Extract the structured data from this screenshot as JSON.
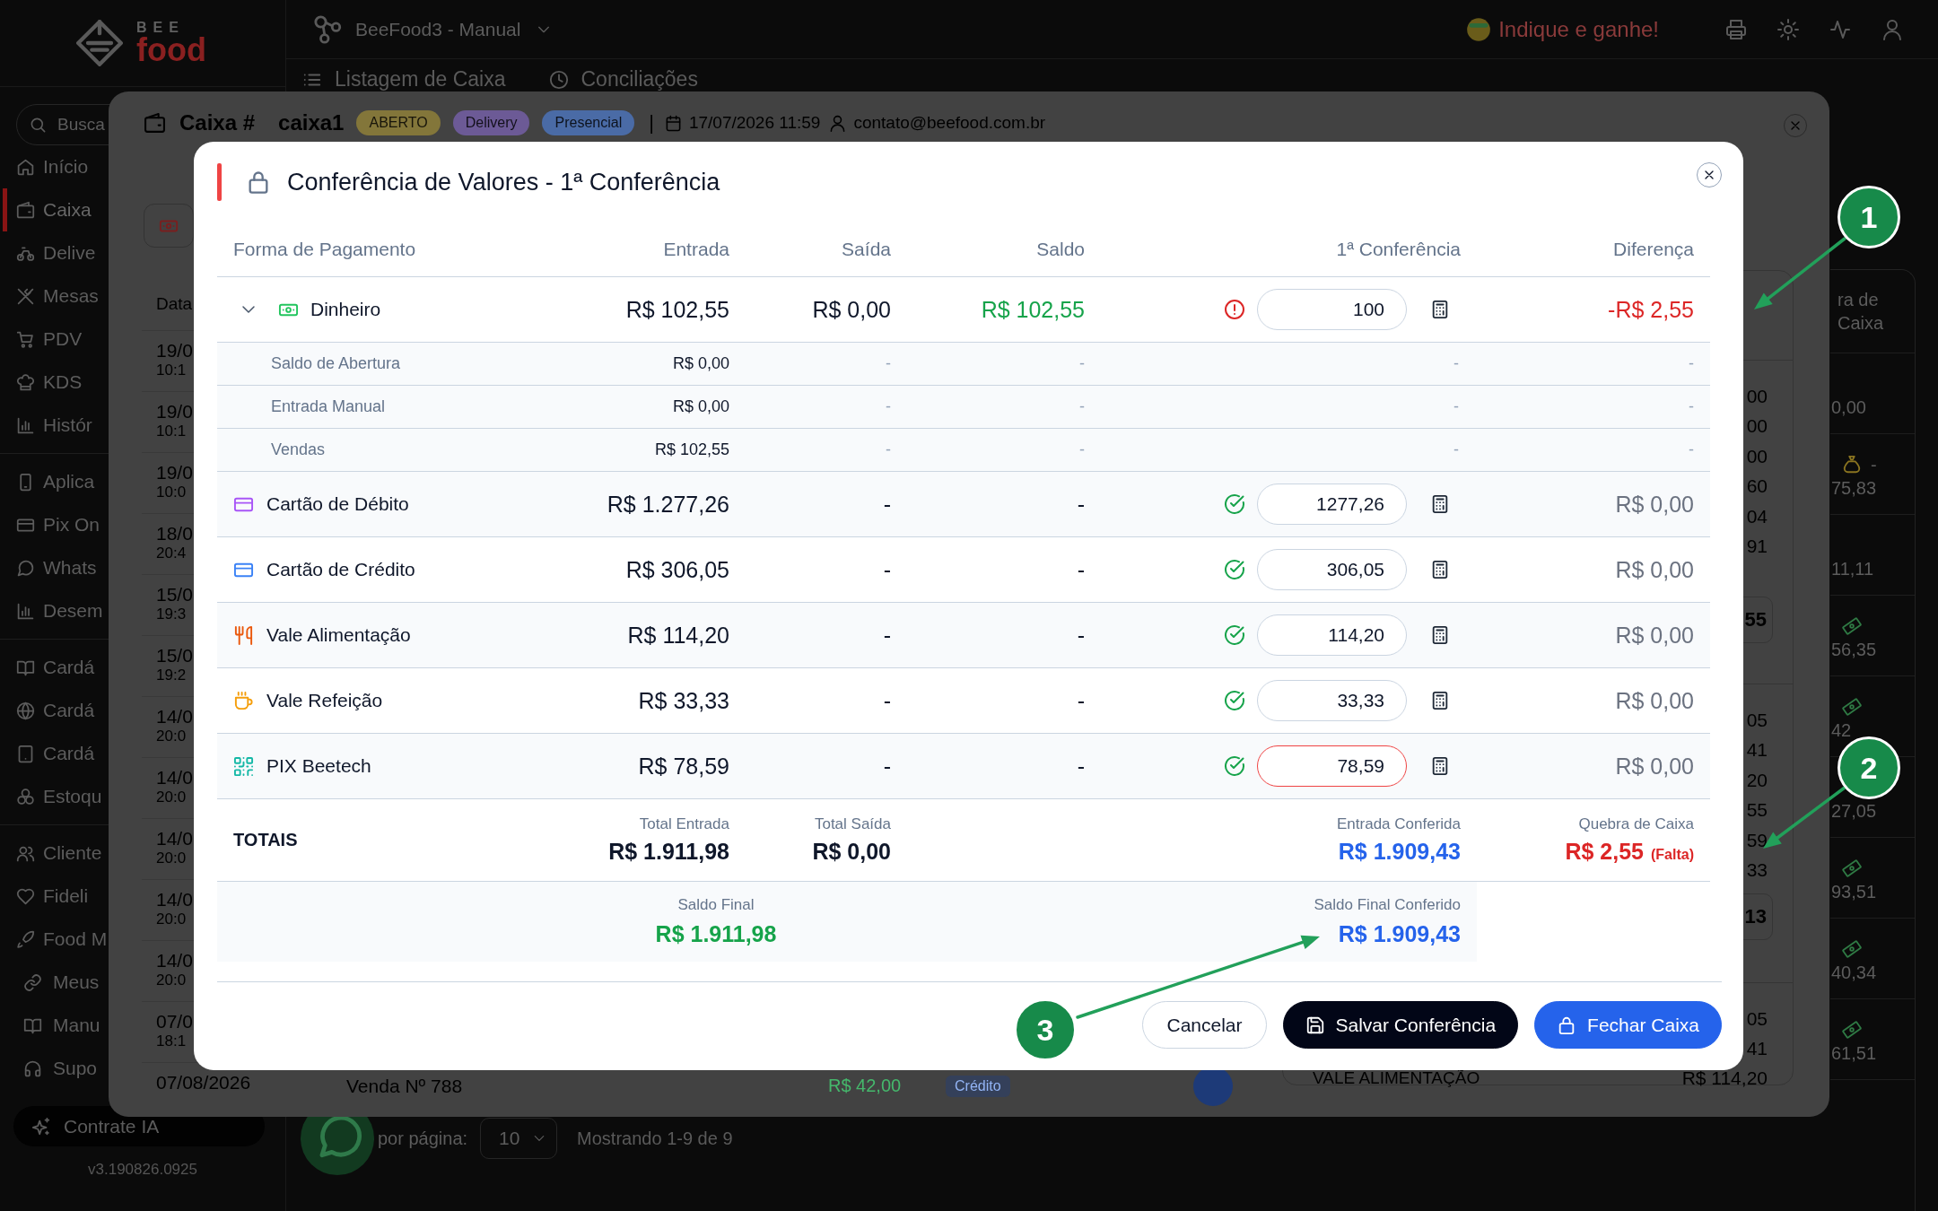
{
  "app": {
    "logo": {
      "top": "BEE",
      "bottom": "food"
    },
    "store_selector": {
      "label": "BeeFood3 - Manual"
    },
    "referral": {
      "label": "Indique e ganhe!"
    },
    "page_tabs": [
      {
        "label": "Listagem de Caixa"
      },
      {
        "label": "Conciliações"
      }
    ],
    "sidebar": {
      "search": {
        "placeholder": "Busca"
      },
      "groups": [
        {
          "items": [
            {
              "kind": "home",
              "label": "Início",
              "selected": false
            },
            {
              "kind": "wallet",
              "label": "Caixa",
              "selected": true
            },
            {
              "kind": "bike",
              "label": "Delive",
              "selected": false
            },
            {
              "kind": "dining",
              "label": "Mesas",
              "selected": false
            },
            {
              "kind": "cart",
              "label": "PDV",
              "selected": false
            },
            {
              "kind": "chef",
              "label": "KDS",
              "selected": false
            },
            {
              "kind": "chart",
              "label": "Histór",
              "selected": false
            }
          ]
        },
        {
          "items": [
            {
              "kind": "phone",
              "label": "Aplica",
              "selected": false
            },
            {
              "kind": "card",
              "label": "Pix On",
              "selected": false
            },
            {
              "kind": "chat",
              "label": "Whats",
              "selected": false
            },
            {
              "kind": "chart",
              "label": "Desem",
              "selected": false
            }
          ]
        },
        {
          "items": [
            {
              "kind": "book",
              "label": "Cardá",
              "selected": false
            },
            {
              "kind": "globe",
              "label": "Cardá",
              "selected": false
            },
            {
              "kind": "tablet",
              "label": "Cardá",
              "selected": false
            },
            {
              "kind": "boxes",
              "label": "Estoqu",
              "selected": false
            }
          ]
        },
        {
          "items": [
            {
              "kind": "users",
              "label": "Cliente",
              "selected": false
            },
            {
              "kind": "heart",
              "label": "Fideli",
              "selected": false
            },
            {
              "kind": "rocket",
              "label": "Food M",
              "selected": false
            }
          ]
        }
      ],
      "footer_links": [
        {
          "kind": "link",
          "label": "Meus"
        },
        {
          "kind": "book",
          "label": "Manu"
        },
        {
          "kind": "headset",
          "label": "Supo"
        }
      ],
      "cta": {
        "label": "Contrate IA"
      },
      "version": "v3.190826.0925"
    },
    "table_card": {
      "header": "ra de Caixa",
      "rows": [
        {
          "kind": "plain",
          "value": "0,00"
        },
        {
          "kind": "bag",
          "note": "-",
          "value": "75,83"
        },
        {
          "kind": "plain",
          "value": "11,11"
        },
        {
          "kind": "cash",
          "value": "56,35"
        },
        {
          "kind": "cash",
          "value": "42"
        },
        {
          "kind": "plain",
          "value": "27,05"
        },
        {
          "kind": "cash",
          "value": "93,51"
        },
        {
          "kind": "cash",
          "value": "40,34"
        },
        {
          "kind": "cash",
          "value": "61,51"
        }
      ]
    },
    "pagination": {
      "per_page_label": "por página:",
      "per_page": "10",
      "summary": "Mostrando 1-9 de 9"
    }
  },
  "cash_dialog": {
    "title": "Caixa #",
    "register": "caixa1",
    "badges": [
      {
        "label": "ABERTO",
        "color": "#83763a"
      },
      {
        "label": "Delivery",
        "color": "#6c5a96"
      },
      {
        "label": "Presencial",
        "color": "#4a6ba6"
      }
    ],
    "separator": "|",
    "opened_at": "17/07/2026 11:59",
    "user": "contato@beefood.com.br",
    "sales": {
      "column": "Data",
      "rows": [
        {
          "date": "19/0",
          "time": "10:1"
        },
        {
          "date": "19/0",
          "time": "10:1"
        },
        {
          "date": "19/0",
          "time": "10:0"
        },
        {
          "date": "18/0",
          "time": "20:4"
        },
        {
          "date": "15/0",
          "time": "19:3"
        },
        {
          "date": "15/0",
          "time": "19:2"
        },
        {
          "date": "14/0",
          "time": "20:0"
        },
        {
          "date": "14/0",
          "time": "20:0"
        },
        {
          "date": "14/0",
          "time": "20:0"
        },
        {
          "date": "14/0",
          "time": "20:0"
        },
        {
          "date": "14/0",
          "time": "20:0"
        },
        {
          "date": "07/0",
          "time": "18:1"
        }
      ],
      "last_row": {
        "date": "07/08/2026",
        "title": "Venda Nº 788",
        "amount": "R$ 42,00",
        "method": "Crédito"
      }
    },
    "summary": {
      "sections": [
        {
          "values": [
            "00",
            "00",
            "00",
            "60",
            "04",
            "91"
          ],
          "total": "55"
        },
        {
          "values": [
            "05",
            "41",
            "20",
            "55",
            "59",
            "33"
          ],
          "total": "13"
        },
        {
          "values": [
            "05",
            "41"
          ]
        }
      ],
      "last_row": {
        "label": "VALE ALIMENTAÇÃO",
        "value": "R$ 114,20"
      }
    }
  },
  "conference_dialog": {
    "title": "Conferência de Valores - 1ª Conferência",
    "columns": [
      "Forma de Pagamento",
      "Entrada",
      "Saída",
      "Saldo",
      "1ª Conferência",
      "Diferença"
    ],
    "methods": [
      {
        "kind": "cash",
        "name": "Dinheiro",
        "color": "#22c55e",
        "expanded": true,
        "entrada": "R$ 102,55",
        "saida": "R$ 0,00",
        "saldo": "R$ 102,55",
        "saldo_highlighted": true,
        "matched": false,
        "counted": "100",
        "focused": false,
        "difference": "-R$ 2,55",
        "breakdown": [
          {
            "label": "Saldo de Abertura",
            "entrada": "R$ 0,00",
            "saida": "-",
            "saldo": "-",
            "counted": "-",
            "difference": "-"
          },
          {
            "label": "Entrada Manual",
            "entrada": "R$ 0,00",
            "saida": "-",
            "saldo": "-",
            "counted": "-",
            "difference": "-"
          },
          {
            "label": "Vendas",
            "entrada": "R$ 102,55",
            "saida": "-",
            "saldo": "-",
            "counted": "-",
            "difference": "-"
          }
        ]
      },
      {
        "kind": "debit_card",
        "name": "Cartão de Débito",
        "color": "#a855f7",
        "entrada": "R$ 1.277,26",
        "saida": "-",
        "saldo": "-",
        "saldo_highlighted": false,
        "matched": true,
        "counted": "1277,26",
        "focused": false,
        "difference": "R$ 0,00"
      },
      {
        "kind": "credit_card",
        "name": "Cartão de Crédito",
        "color": "#3b82f6",
        "entrada": "R$ 306,05",
        "saida": "-",
        "saldo": "-",
        "saldo_highlighted": false,
        "matched": true,
        "counted": "306,05",
        "focused": false,
        "difference": "R$ 0,00"
      },
      {
        "kind": "meal_voucher",
        "name": "Vale Alimentação",
        "color": "#ea580c",
        "entrada": "R$ 114,20",
        "saida": "-",
        "saldo": "-",
        "saldo_highlighted": false,
        "matched": true,
        "counted": "114,20",
        "focused": false,
        "difference": "R$ 0,00"
      },
      {
        "kind": "food_voucher",
        "name": "Vale Refeição",
        "color": "#f59e0b",
        "entrada": "R$ 33,33",
        "saida": "-",
        "saldo": "-",
        "saldo_highlighted": false,
        "matched": true,
        "counted": "33,33",
        "focused": false,
        "difference": "R$ 0,00"
      },
      {
        "kind": "pix",
        "name": "PIX Beetech",
        "color": "#14b8a6",
        "entrada": "R$ 78,59",
        "saida": "-",
        "saldo": "-",
        "saldo_highlighted": false,
        "matched": true,
        "counted": "78,59",
        "focused": true,
        "difference": "R$ 0,00"
      }
    ],
    "totals": {
      "label": "TOTAIS",
      "total_in": {
        "label": "Total Entrada",
        "value": "R$ 1.911,98"
      },
      "total_out": {
        "label": "Total Saída",
        "value": "R$ 0,00"
      },
      "counted_in": {
        "label": "Entrada Conferida",
        "value": "R$ 1.909,43"
      },
      "shortfall": {
        "label": "Quebra de Caixa",
        "value": "R$ 2,55",
        "note": "(Falta)"
      }
    },
    "final": {
      "balance": {
        "label": "Saldo Final",
        "value": "R$ 1.911,98"
      },
      "counted_balance": {
        "label": "Saldo Final Conferido",
        "value": "R$ 1.909,43"
      }
    },
    "buttons": [
      {
        "kind": "outline",
        "label": "Cancelar"
      },
      {
        "kind": "dark",
        "label": "Salvar Conferência"
      },
      {
        "kind": "primary",
        "label": "Fechar Caixa"
      }
    ]
  },
  "annotations": [
    {
      "label": "1"
    },
    {
      "label": "2"
    },
    {
      "label": "3"
    }
  ]
}
